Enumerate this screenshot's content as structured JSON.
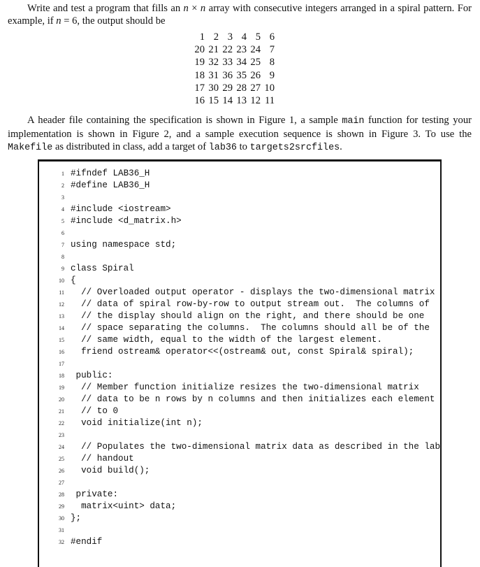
{
  "intro": {
    "part1": "Write and test a program that fills an ",
    "math1": "n",
    "times": " × ",
    "math2": "n",
    "part2": " array with consecutive integers arranged in a spiral pattern. For example, if ",
    "math3": "n",
    "part3": " = 6, the output should be"
  },
  "spiral_example": {
    "n": 6,
    "rows": [
      [
        "1",
        "2",
        "3",
        "4",
        "5",
        "6"
      ],
      [
        "20",
        "21",
        "22",
        "23",
        "24",
        "7"
      ],
      [
        "19",
        "32",
        "33",
        "34",
        "25",
        "8"
      ],
      [
        "18",
        "31",
        "36",
        "35",
        "26",
        "9"
      ],
      [
        "17",
        "30",
        "29",
        "28",
        "27",
        "10"
      ],
      [
        "16",
        "15",
        "14",
        "13",
        "12",
        "11"
      ]
    ]
  },
  "instructions": {
    "part1": "A header file containing the specification is shown in Figure 1, a sample ",
    "code_main": "main",
    "part2": " function for testing your implementation is shown in Figure 2, and a sample execution sequence is shown in Figure 3. To use the ",
    "code_makefile": "Makefile",
    "part3": " as distributed in class, add a target of ",
    "code_lab36": "lab36",
    "part4": " to ",
    "code_targets": "targets2srcfiles",
    "part5": "."
  },
  "code_listing": {
    "lines": [
      {
        "n": "1",
        "text": "#ifndef LAB36_H"
      },
      {
        "n": "2",
        "text": "#define LAB36_H"
      },
      {
        "n": "3",
        "text": ""
      },
      {
        "n": "4",
        "text": "#include <iostream>"
      },
      {
        "n": "5",
        "text": "#include <d_matrix.h>"
      },
      {
        "n": "6",
        "text": ""
      },
      {
        "n": "7",
        "text": "using namespace std;"
      },
      {
        "n": "8",
        "text": ""
      },
      {
        "n": "9",
        "text": "class Spiral"
      },
      {
        "n": "10",
        "text": "{"
      },
      {
        "n": "11",
        "text": "  // Overloaded output operator - displays the two-dimensional matrix"
      },
      {
        "n": "12",
        "text": "  // data of spiral row-by-row to output stream out.  The columns of"
      },
      {
        "n": "13",
        "text": "  // the display should align on the right, and there should be one"
      },
      {
        "n": "14",
        "text": "  // space separating the columns.  The columns should all be of the"
      },
      {
        "n": "15",
        "text": "  // same width, equal to the width of the largest element."
      },
      {
        "n": "16",
        "text": "  friend ostream& operator<<(ostream& out, const Spiral& spiral);"
      },
      {
        "n": "17",
        "text": ""
      },
      {
        "n": "18",
        "text": " public:"
      },
      {
        "n": "19",
        "text": "  // Member function initialize resizes the two-dimensional matrix"
      },
      {
        "n": "20",
        "text": "  // data to be n rows by n columns and then initializes each element"
      },
      {
        "n": "21",
        "text": "  // to 0"
      },
      {
        "n": "22",
        "text": "  void initialize(int n);"
      },
      {
        "n": "23",
        "text": ""
      },
      {
        "n": "24",
        "text": "  // Populates the two-dimensional matrix data as described in the lab"
      },
      {
        "n": "25",
        "text": "  // handout"
      },
      {
        "n": "26",
        "text": "  void build();"
      },
      {
        "n": "27",
        "text": ""
      },
      {
        "n": "28",
        "text": " private:"
      },
      {
        "n": "29",
        "text": "  matrix<uint> data;"
      },
      {
        "n": "30",
        "text": "};"
      },
      {
        "n": "31",
        "text": ""
      },
      {
        "n": "32",
        "text": "#endif"
      }
    ]
  }
}
